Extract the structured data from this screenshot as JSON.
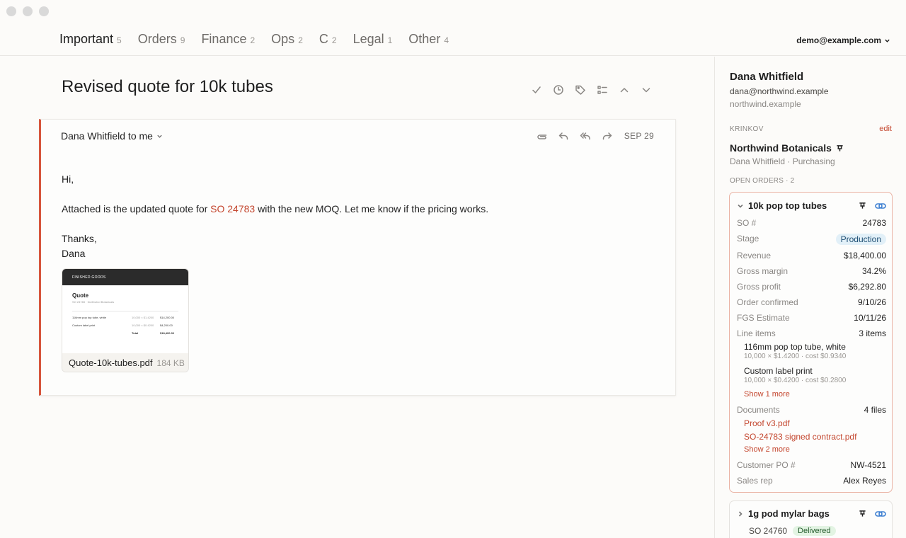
{
  "tabs": [
    {
      "label": "Important",
      "count": "5"
    },
    {
      "label": "Orders",
      "count": "9"
    },
    {
      "label": "Finance",
      "count": "2"
    },
    {
      "label": "Ops",
      "count": "2"
    },
    {
      "label": "C",
      "count": "2"
    },
    {
      "label": "Legal",
      "count": "1"
    },
    {
      "label": "Other",
      "count": "4"
    }
  ],
  "account": "demo@example.com",
  "thread": {
    "subject": "Revised quote for 10k tubes",
    "from_line": "Dana Whitfield to me",
    "date": "SEP 29",
    "greeting": "Hi,",
    "body_before": "Attached is the updated quote for ",
    "body_link": "SO 24783",
    "body_after": " with the new MOQ. Let me know if the pricing works.",
    "signoff": "Thanks,",
    "signature": "Dana",
    "attachment": {
      "filename": "Quote-10k-tubes.pdf",
      "size": "184 KB",
      "thumb_header": "FINISHED GOODS",
      "thumb_title": "Quote",
      "thumb_sub": "SO 24783 · Northwind Botanicals",
      "thumb_rows": [
        {
          "a": "116mm pop top tube, white",
          "b": "10,000 × $1.4200",
          "c": "$14,200.00"
        },
        {
          "a": "Custom label print",
          "b": "10,000 × $0.4200",
          "c": "$4,200.00"
        },
        {
          "a": "",
          "b": "Total",
          "c": "$18,400.00"
        }
      ]
    }
  },
  "contact": {
    "name": "Dana Whitfield",
    "email": "dana@northwind.example",
    "domain": "northwind.example",
    "section_label": "KRINKOV",
    "edit_label": "edit",
    "company": "Northwind Botanicals",
    "role": "Dana Whitfield · Purchasing",
    "open_orders_label": "OPEN ORDERS · 2"
  },
  "order1": {
    "title": "10k pop top tubes",
    "so_label": "SO #",
    "so_value": "24783",
    "stage_label": "Stage",
    "stage_value": "Production",
    "revenue_label": "Revenue",
    "revenue_value": "$18,400.00",
    "margin_label": "Gross margin",
    "margin_value": "34.2%",
    "profit_label": "Gross profit",
    "profit_value": "$6,292.80",
    "confirmed_label": "Order confirmed",
    "confirmed_value": "9/10/26",
    "fgs_label": "FGS Estimate",
    "fgs_value": "10/11/26",
    "line_items_label": "Line items",
    "line_items_value": "3 items",
    "line_items": [
      {
        "name": "116mm pop top tube, white",
        "detail": "10,000 × $1.4200 · cost $0.9340"
      },
      {
        "name": "Custom label print",
        "detail": "10,000 × $0.4200 · cost $0.2800"
      }
    ],
    "line_more": "Show 1 more",
    "documents_label": "Documents",
    "documents_value": "4 files",
    "documents": [
      "Proof v3.pdf",
      "SO-24783 signed contract.pdf"
    ],
    "docs_more": "Show 2 more",
    "po_label": "Customer PO #",
    "po_value": "NW-4521",
    "rep_label": "Sales rep",
    "rep_value": "Alex Reyes"
  },
  "order2": {
    "title": "1g pod mylar bags",
    "so": "SO 24760",
    "stage": "Delivered"
  },
  "colors": {
    "accent": "#c4472f",
    "link_blue": "#3d7fd1",
    "production_bg": "#e2f0f8",
    "delivered_bg": "#e3f4e3"
  }
}
